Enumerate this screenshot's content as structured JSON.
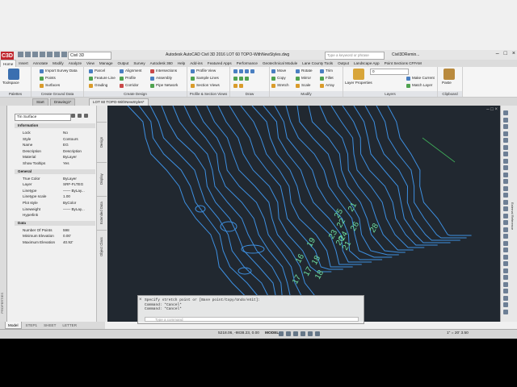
{
  "app": {
    "title": "Autodesk AutoCAD Civil 3D 2016    LOT 60 TOPO-WithNewStyles.dwg",
    "app_button": "C3D",
    "workspace": "Civil 3D",
    "search_placeholder": "Type a keyword or phrase",
    "user": "Civil3DRemin...",
    "window_controls": [
      "–",
      "□",
      "×"
    ]
  },
  "ribbon_tabs": [
    "Home",
    "Insert",
    "Annotate",
    "Modify",
    "Analyze",
    "View",
    "Manage",
    "Output",
    "Survey",
    "Autodesk 360",
    "Help",
    "Add-ins",
    "Featured Apps",
    "Performance",
    "Geotechnical Module",
    "Lane County Tools",
    "Output",
    "Landscape App",
    "Point Sections CFFAM"
  ],
  "ribbon": {
    "palettes": {
      "big": "Toolspace",
      "title": "Palettes"
    },
    "create_ground": {
      "items": [
        "Import Survey Data",
        "Points",
        "Surfaces"
      ],
      "title": "Create Ground Data"
    },
    "create_design1": {
      "items": [
        "Parcel",
        "Feature Line",
        "Grading"
      ]
    },
    "create_design2": {
      "items": [
        "Alignment",
        "Profile",
        "Corridor"
      ],
      "title": "Create Design"
    },
    "create_design3": {
      "items": [
        "Intersections",
        "Assembly",
        "Pipe Network"
      ]
    },
    "profile_section": {
      "items": [
        "Profile View",
        "Sample Lines",
        "Section Views"
      ],
      "title": "Profile & Section Views"
    },
    "draw": {
      "title": "Draw"
    },
    "modify": {
      "items": [
        "Move",
        "Rotate",
        "Trim",
        "Copy",
        "Mirror",
        "Fillet",
        "Stretch",
        "Scale",
        "Array"
      ],
      "title": "Modify"
    },
    "layers": {
      "big": "Layer Properties",
      "combo": "0",
      "items": [
        "Make Current",
        "Match Layer"
      ],
      "title": "Layers"
    },
    "clipboard": {
      "big": "Paste",
      "title": "Clipboard"
    }
  },
  "doc_tabs": [
    "Start",
    "Drawing1*",
    "LOT 60 TOPO-WithNewStyles*"
  ],
  "properties": {
    "selected": "Tin Surface",
    "side_tabs": [
      "Design",
      "Display",
      "Extended Data",
      "Object Class"
    ],
    "strip_label": "PROPERTIES",
    "sections": [
      {
        "title": "Information",
        "rows": [
          [
            "Lock",
            "No"
          ],
          [
            "Style",
            "Contours"
          ],
          [
            "Name",
            "EG"
          ],
          [
            "Description",
            "Description"
          ],
          [
            "Material",
            "ByLayer"
          ],
          [
            "Show Tooltips",
            "Yes"
          ]
        ]
      },
      {
        "title": "General",
        "rows": [
          [
            "True Color",
            "ByLayer"
          ],
          [
            "Layer",
            "SRF-FLTEG"
          ],
          [
            "Linetype",
            "—— ByLay..."
          ],
          [
            "Linetype scale",
            "1.00"
          ],
          [
            "Plot style",
            "ByColor"
          ],
          [
            "Lineweight",
            "—— ByLay..."
          ],
          [
            "Hyperlink",
            ""
          ]
        ]
      },
      {
        "title": "Data",
        "rows": [
          [
            "Number Of Points",
            "598"
          ],
          [
            "Minimum Elevation",
            "0.00'"
          ],
          [
            "Maximum Elevation",
            "40.92'"
          ]
        ]
      }
    ]
  },
  "contour_labels": [
    "21",
    "25",
    "26",
    "22",
    "28",
    "23",
    "24",
    "20",
    "21",
    "19",
    "18",
    "17",
    "16",
    "17",
    "18"
  ],
  "command": {
    "lines": [
      "Specify stretch point or [Base point/Copy/Undo/eXit]:",
      "Command: *Cancel*",
      "Command: *Cancel*"
    ],
    "placeholder": "Type a command"
  },
  "layout_tabs": [
    "Model",
    "STEP1",
    "SHEET",
    "LETTER"
  ],
  "status": {
    "coords": "5218.06, -9838.23, 0.00",
    "mode": "MODEL",
    "scale": "1\" = 20'",
    "zoom": "3.50"
  },
  "colors": {
    "canvas": "#212830",
    "contour": "#3d8fe0",
    "label": "#6ee0a0"
  }
}
